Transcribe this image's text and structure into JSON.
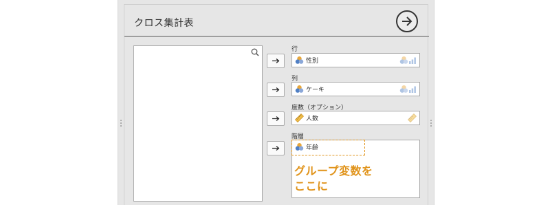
{
  "panel": {
    "title": "クロス集計表"
  },
  "targets": {
    "rows": {
      "label": "行",
      "variable": "性別",
      "icon": "nominal-icon"
    },
    "columns": {
      "label": "列",
      "variable": "ケーキ",
      "icon": "nominal-icon"
    },
    "counts": {
      "label": "度数（オプション）",
      "variable": "人数",
      "icon": "ruler-icon"
    },
    "layers": {
      "label": "階層",
      "variable": "年齢",
      "icon": "nominal-icon",
      "hint_line1": "グループ変数を",
      "hint_line2": "ここに"
    }
  },
  "colors": {
    "accent_orange": "#e0931a",
    "panel_bg": "#e6e6e6",
    "field_border": "#a9a9a9"
  }
}
